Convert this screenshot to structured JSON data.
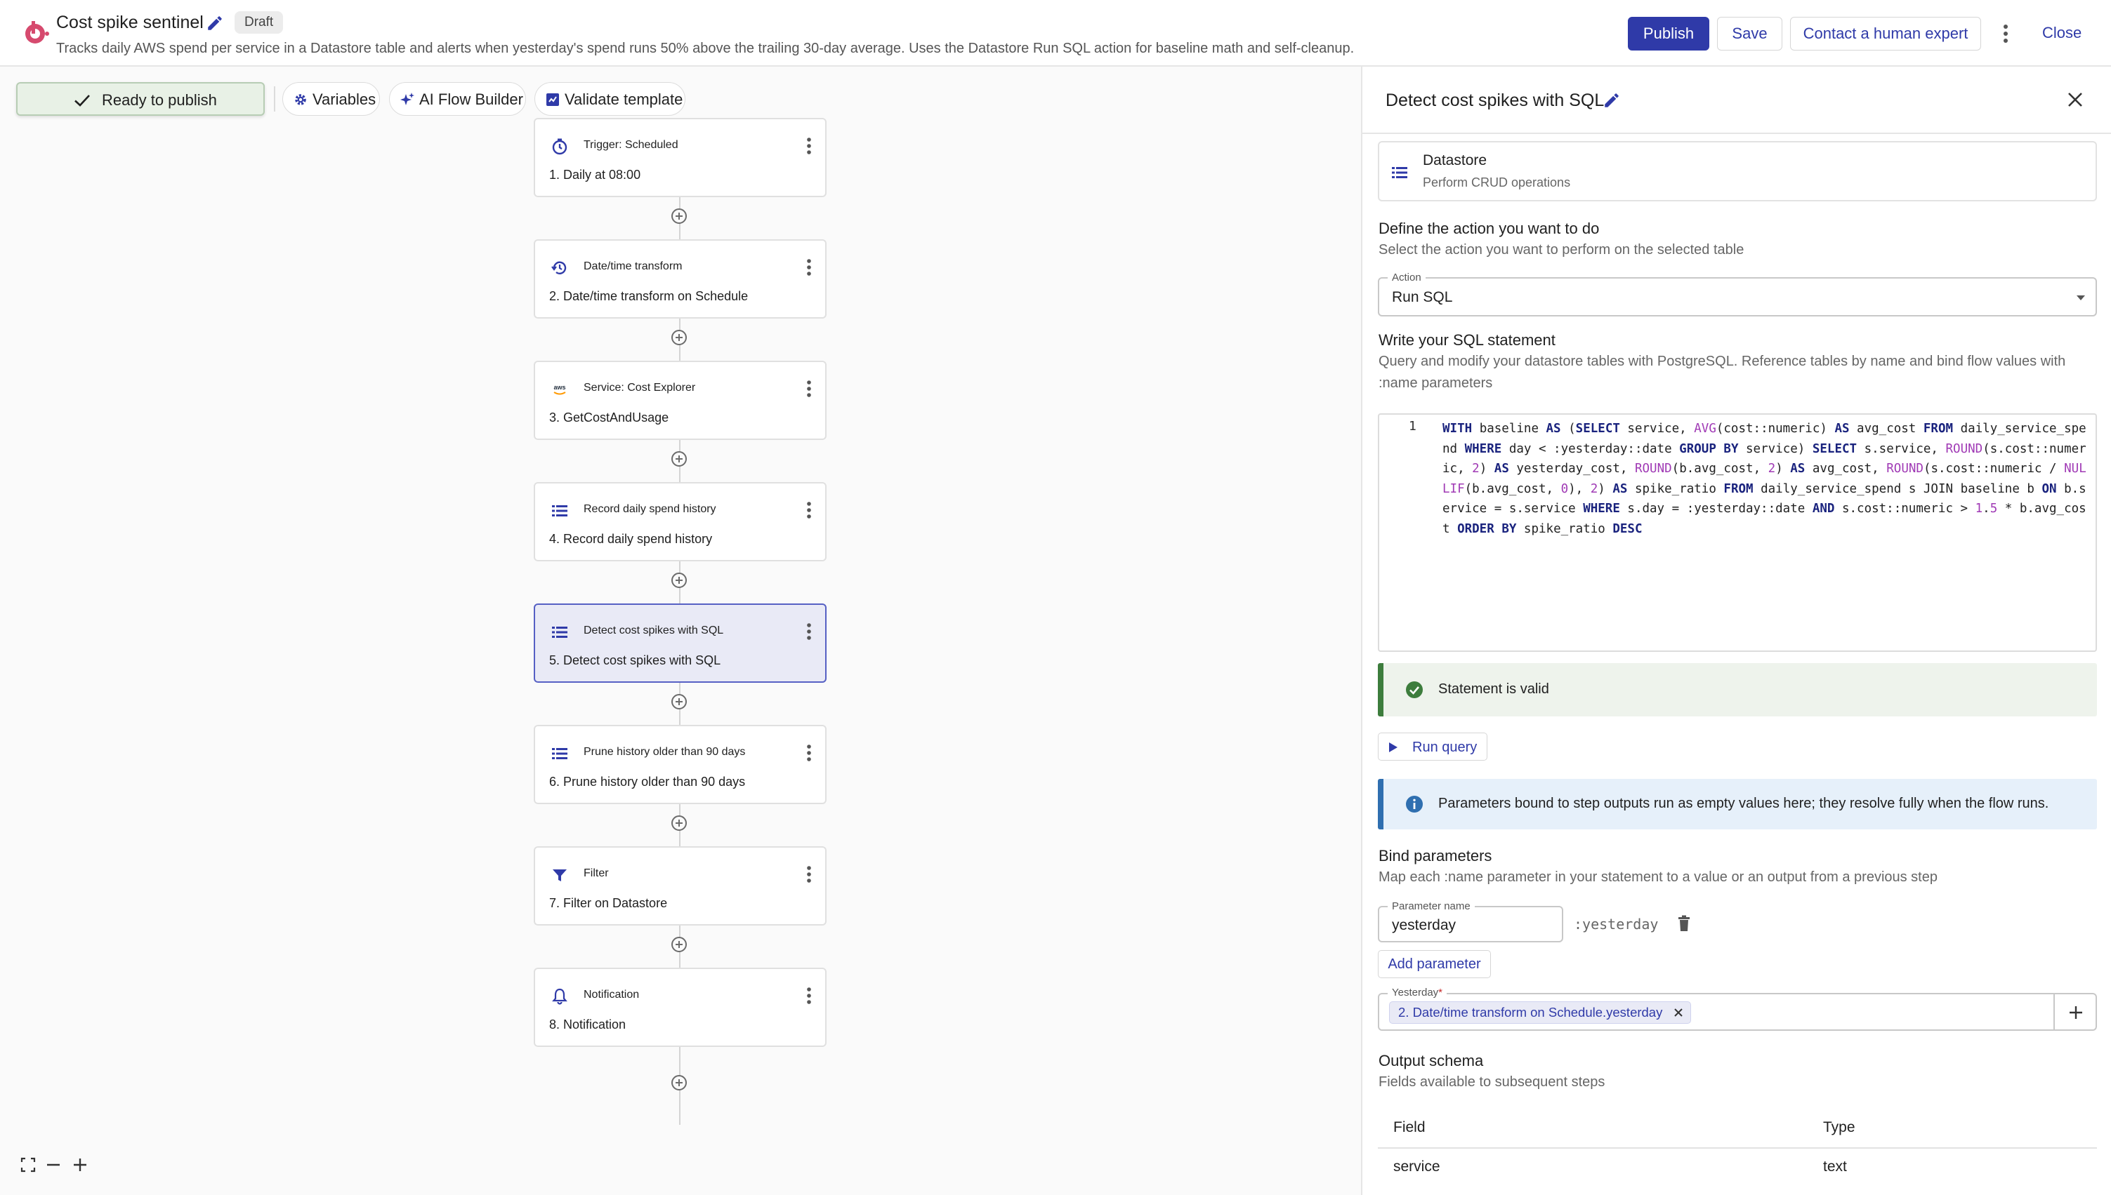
{
  "header": {
    "title": "Cost spike sentinel",
    "badge": "Draft",
    "description": "Tracks daily AWS spend per service in a Datastore table and alerts when yesterday's spend runs 50% above the trailing 30-day average. Uses the Datastore Run SQL action for baseline math and self-cleanup.",
    "publish_label": "Publish",
    "save_label": "Save",
    "expert_label": "Contact a human expert",
    "close_label": "Close"
  },
  "toolbar": {
    "ready_label": "Ready to publish",
    "variables_label": "Variables",
    "ai_flow_label": "AI Flow Builder",
    "validate_label": "Validate template"
  },
  "steps": [
    {
      "type": "Trigger: Scheduled",
      "name": "1. Daily at 08:00",
      "icon": "stopwatch-icon"
    },
    {
      "type": "Date/time transform",
      "name": "2. Date/time transform on Schedule",
      "icon": "clock-transform-icon"
    },
    {
      "type": "Service: Cost Explorer",
      "name": "3. GetCostAndUsage",
      "icon": "aws-icon",
      "icon_text": "aws"
    },
    {
      "type": "Record daily spend history",
      "name": "4. Record daily spend history",
      "icon": "datastore-icon"
    },
    {
      "type": "Detect cost spikes with SQL",
      "name": "5. Detect cost spikes with SQL",
      "icon": "datastore-icon",
      "selected": true
    },
    {
      "type": "Prune history older than 90 days",
      "name": "6. Prune history older than 90 days",
      "icon": "datastore-icon"
    },
    {
      "type": "Filter",
      "name": "7. Filter on Datastore",
      "icon": "filter-icon"
    },
    {
      "type": "Notification",
      "name": "8. Notification",
      "icon": "bell-icon"
    }
  ],
  "panel": {
    "title": "Detect cost spikes with SQL",
    "datastore": {
      "title": "Datastore",
      "subtitle": "Perform CRUD operations"
    },
    "define_heading": "Define the action you want to do",
    "define_sub": "Select the action you want to perform on the selected table",
    "action_label": "Action",
    "action_value": "Run SQL",
    "sql_heading": "Write your SQL statement",
    "sql_sub": "Query and modify your datastore tables with PostgreSQL. Reference tables by name and bind flow values with :name parameters",
    "sql_line_number": "1",
    "sql": "WITH baseline AS (SELECT service, AVG(cost::numeric) AS avg_cost FROM daily_service_spend WHERE day < :yesterday::date GROUP BY service) SELECT s.service, ROUND(s.cost::numeric, 2) AS yesterday_cost, ROUND(b.avg_cost, 2) AS avg_cost, ROUND(s.cost::numeric / NULLIF(b.avg_cost, 0), 2) AS spike_ratio FROM daily_service_spend s JOIN baseline b ON b.service = s.service WHERE s.day = :yesterday::date AND s.cost::numeric > 1.5 * b.avg_cost ORDER BY spike_ratio DESC",
    "valid_label": "Statement is valid",
    "run_label": "Run query",
    "info_label": "Parameters bound to step outputs run as empty values here; they resolve fully when the flow runs.",
    "bind_heading": "Bind parameters",
    "bind_sub": "Map each :name parameter in your statement to a value or an output from a previous step",
    "param_name_label": "Parameter name",
    "param_name_value": "yesterday",
    "param_token": ":yesterday",
    "add_param_label": "Add parameter",
    "yesterday_label": "Yesterday",
    "yesterday_required": "*",
    "yesterday_chip": "2. Date/time transform on Schedule.yesterday",
    "output_heading": "Output schema",
    "output_sub": "Fields available to subsequent steps",
    "schema_columns": [
      "Field",
      "Type"
    ],
    "schema_rows": [
      {
        "field": "service",
        "type": "text"
      }
    ]
  },
  "colors": {
    "accent": "#2f3aa8",
    "logo": "#d64a6e",
    "valid": "#3d7d3d",
    "info": "#2f6fb0",
    "selected_card": "#e9eaf6"
  }
}
